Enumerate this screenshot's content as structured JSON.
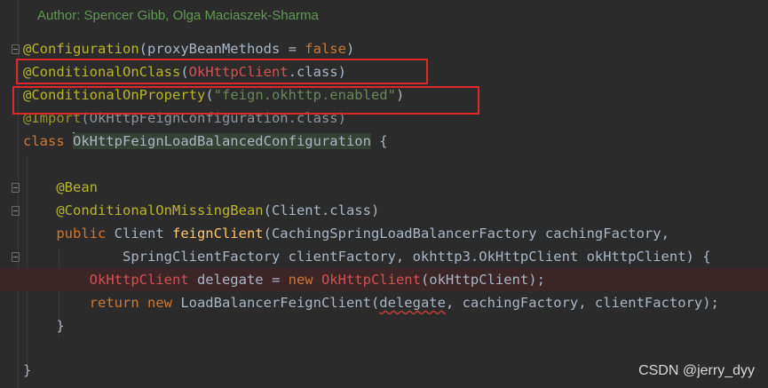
{
  "doc_comment": "Author: Spencer Gibb, Olga Maciaszek-Sharma",
  "lines": {
    "l1": {
      "ann": "@Configuration",
      "p1": "(proxyBeanMethods = ",
      "kw": "false",
      "p2": ")"
    },
    "l2": {
      "ann": "@ConditionalOnClass",
      "p1": "(",
      "cls": "OkHttpClient",
      "p2": ".class)"
    },
    "l3": {
      "ann": "@ConditionalOnProperty",
      "p1": "(",
      "str": "\"feign.okhttp.enabled\"",
      "p2": ")"
    },
    "l4": {
      "ann": "@Import",
      "p1": "(OkHttpFeignConfiguration.class)"
    },
    "l5": {
      "kw": "class ",
      "name": "OkHttpFeignLoadBalancedConfiguration",
      "p1": " {"
    },
    "l7": {
      "ann": "@Bean"
    },
    "l8": {
      "ann": "@ConditionalOnMissingBean",
      "p1": "(Client.class)"
    },
    "l9": {
      "kw": "public ",
      "type": "Client ",
      "fn": "feignClient",
      "p1": "(CachingSpringLoadBalancerFactory cachingFactory,"
    },
    "l10": {
      "p1": "SpringClientFactory clientFactory, okhttp3.OkHttpClient okHttpClient) {"
    },
    "l11": {
      "cls": "OkHttpClient",
      "p1": " delegate = ",
      "kw": "new ",
      "cls2": "OkHttpClient",
      "p2": "(okHttpClient);"
    },
    "l12": {
      "kw1": "return ",
      "kw2": "new ",
      "p1": "LoadBalancerFeignClient(",
      "sq": "delegate",
      "p2": ", cachingFactory, clientFactory);"
    },
    "l13": {
      "p1": "}"
    },
    "l15": {
      "p1": "}"
    }
  },
  "watermark": "CSDN @jerry_dyy",
  "colors": {
    "background": "#2b2b2b",
    "annotation": "#bbb529",
    "keyword": "#cc7832",
    "string": "#6a8759",
    "error_class": "#d25252",
    "default_text": "#a9b7c6",
    "method": "#ffc66d",
    "comment": "#629755",
    "highlight_box": "#e0262b"
  }
}
